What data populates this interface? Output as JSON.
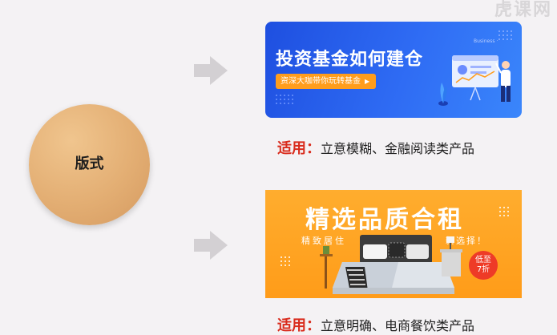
{
  "watermark": "虎课网",
  "center": {
    "label": "版式"
  },
  "banners": [
    {
      "title": "投资基金如何建仓",
      "pill_text": "资深大咖带你玩转基金",
      "chart_text": "Business ·"
    },
    {
      "title": "精选品质合租",
      "sub_left": "精致居住",
      "sub_right": "新选择！",
      "badge_line1": "低至",
      "badge_line2": "7折"
    }
  ],
  "captions": [
    {
      "lead": "适用：",
      "text": "立意模糊、金融阅读类产品"
    },
    {
      "lead": "适用：",
      "text": "立意明确、电商餐饮类产品"
    }
  ],
  "colors": {
    "background": "#f4f2f4",
    "circle": "#e3ae73",
    "banner1": "#2f6cf4",
    "banner2": "#ff9c19",
    "accent_red": "#d92b1c",
    "arrow": "#d3d0d3"
  }
}
